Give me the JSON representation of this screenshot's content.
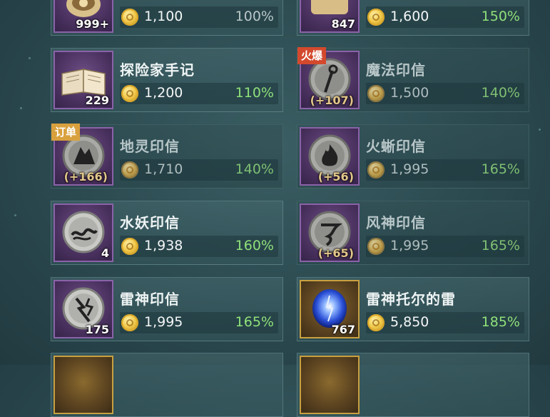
{
  "colors": {
    "positive": "#8fe07a",
    "neutral": "#b9c7c8",
    "hot_badge": "#d3492d",
    "order_badge": "#d9a13e"
  },
  "items": [
    {
      "id": "row0-left",
      "name": "",
      "qty": "999+",
      "price": "1,100",
      "pct": "100%",
      "icon": "treasure-icon"
    },
    {
      "id": "row0-right",
      "name": "",
      "qty": "847",
      "price": "1,600",
      "pct": "150%",
      "icon": "scroll-icon"
    },
    {
      "id": "row1-left",
      "name": "探险家手记",
      "qty": "229",
      "price": "1,200",
      "pct": "110%",
      "icon": "book-icon"
    },
    {
      "id": "row1-right",
      "name": "魔法印信",
      "qty": "(+107)",
      "price": "1,500",
      "pct": "140%",
      "badge": "火爆",
      "icon": "magic-seal-icon"
    },
    {
      "id": "row2-left",
      "name": "地灵印信",
      "qty": "(+166)",
      "price": "1,710",
      "pct": "140%",
      "badge": "订单",
      "icon": "earth-seal-icon"
    },
    {
      "id": "row2-right",
      "name": "火蜥印信",
      "qty": "(+56)",
      "price": "1,995",
      "pct": "165%",
      "icon": "fire-seal-icon"
    },
    {
      "id": "row3-left",
      "name": "水妖印信",
      "qty": "4",
      "price": "1,938",
      "pct": "160%",
      "icon": "water-seal-icon"
    },
    {
      "id": "row3-right",
      "name": "风神印信",
      "qty": "(+65)",
      "price": "1,995",
      "pct": "165%",
      "icon": "wind-seal-icon"
    },
    {
      "id": "row4-left",
      "name": "雷神印信",
      "qty": "175",
      "price": "1,995",
      "pct": "165%",
      "icon": "thunder-seal-icon"
    },
    {
      "id": "row4-right",
      "name": "雷神托尔的雷",
      "qty": "767",
      "price": "5,850",
      "pct": "185%",
      "icon": "thunder-orb-icon"
    }
  ]
}
